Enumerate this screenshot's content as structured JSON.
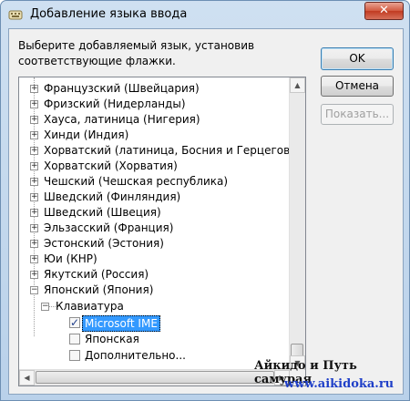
{
  "window": {
    "title": "Добавление языка ввода",
    "close_label": "✕"
  },
  "prompt": "Выберите добавляемый язык, установив соответствующие флажки.",
  "buttons": {
    "ok": "OK",
    "cancel": "Отмена",
    "show": "Показать..."
  },
  "tree": {
    "languages": [
      "Французский (Швейцария)",
      "Фризский (Нидерланды)",
      "Хауса, латиница (Нигерия)",
      "Хинди (Индия)",
      "Хорватский (латиница, Босния и Герцеговина)",
      "Хорватский (Хорватия)",
      "Чешский (Чешская республика)",
      "Шведский (Финляндия)",
      "Шведский (Швеция)",
      "Эльзасский (Франция)",
      "Эстонский (Эстония)",
      "Юи (КНР)",
      "Якутский (Россия)",
      "Японский (Япония)"
    ],
    "keyboard_group": "Клавиатура",
    "keyboards": [
      {
        "label": "Microsoft IME",
        "checked": true,
        "selected": true
      },
      {
        "label": "Японская",
        "checked": false,
        "selected": false
      },
      {
        "label": "Дополнительно...",
        "checked": false,
        "selected": false
      }
    ]
  },
  "watermark": {
    "line1": "Айкидо и Путь самурая",
    "line2": "www.aikidoka.ru"
  }
}
